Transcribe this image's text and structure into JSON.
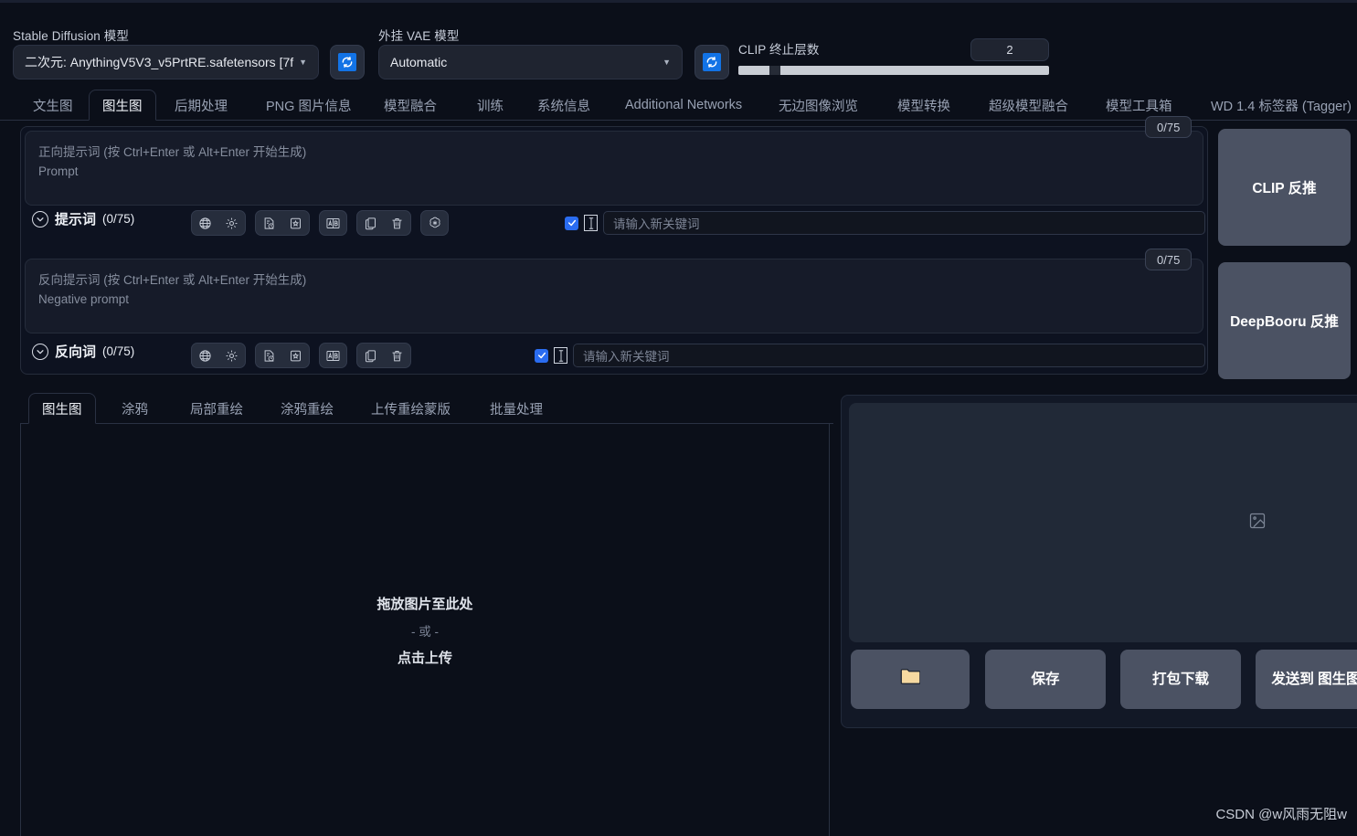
{
  "header": {
    "sd_model_label": "Stable Diffusion 模型",
    "sd_model_value": "二次元: AnythingV5V3_v5PrtRE.safetensors [7f",
    "vae_label": "外挂 VAE 模型",
    "vae_value": "Automatic",
    "clip_label": "CLIP 终止层数",
    "clip_value": "2",
    "refresh_icon": "recycle-icon",
    "accent_blue": "#1273e6"
  },
  "tabs": [
    {
      "label": "文生图",
      "active": false
    },
    {
      "label": "图生图",
      "active": true
    },
    {
      "label": "后期处理",
      "active": false
    },
    {
      "label": "PNG 图片信息",
      "active": false
    },
    {
      "label": "模型融合",
      "active": false
    },
    {
      "label": "训练",
      "active": false
    },
    {
      "label": "系统信息",
      "active": false
    },
    {
      "label": "Additional Networks",
      "active": false
    },
    {
      "label": "无边图像浏览",
      "active": false
    },
    {
      "label": "模型转换",
      "active": false
    },
    {
      "label": "超级模型融合",
      "active": false
    },
    {
      "label": "模型工具箱",
      "active": false
    },
    {
      "label": "WD 1.4 标签器 (Tagger)",
      "active": false
    }
  ],
  "prompt": {
    "placeholder_line1": "正向提示词 (按 Ctrl+Enter 或 Alt+Enter 开始生成)",
    "placeholder_line2": "Prompt",
    "accordion_label": "提示词",
    "accordion_count": "(0/75)",
    "token_badge": "0/75",
    "keyword_placeholder": "请输入新关键词",
    "icons": [
      "globe-icon",
      "gear-icon",
      "history-document-icon",
      "bookmark-star-icon",
      "translate-ab-icon",
      "copy-icon",
      "trash-icon",
      "openai-spiral-icon"
    ]
  },
  "negative_prompt": {
    "placeholder_line1": "反向提示词 (按 Ctrl+Enter 或 Alt+Enter 开始生成)",
    "placeholder_line2": "Negative prompt",
    "accordion_label": "反向词",
    "accordion_count": "(0/75)",
    "token_badge": "0/75",
    "keyword_placeholder": "请输入新关键词",
    "icons": [
      "globe-icon",
      "gear-icon",
      "history-document-icon",
      "bookmark-star-icon",
      "translate-ab-icon",
      "copy-icon",
      "trash-icon"
    ]
  },
  "interrogate": {
    "clip_button": "CLIP 反推",
    "deepbooru_button": "DeepBooru 反推"
  },
  "subtabs": [
    {
      "label": "图生图",
      "active": true
    },
    {
      "label": "涂鸦",
      "active": false
    },
    {
      "label": "局部重绘",
      "active": false
    },
    {
      "label": "涂鸦重绘",
      "active": false
    },
    {
      "label": "上传重绘蒙版",
      "active": false
    },
    {
      "label": "批量处理",
      "active": false
    }
  ],
  "dropzone": {
    "line1": "拖放图片至此处",
    "line2": "- 或 -",
    "line3": "点击上传",
    "placeholder_icon": "image-placeholder-icon"
  },
  "result": {
    "placeholder_icon": "image-placeholder-icon",
    "buttons": [
      {
        "label": "",
        "icon": "folder-icon"
      },
      {
        "label": "保存",
        "icon": ""
      },
      {
        "label": "打包下载",
        "icon": ""
      },
      {
        "label": "发送到 图生图",
        "icon": ""
      }
    ]
  },
  "watermark": "CSDN @w风雨无阻w"
}
